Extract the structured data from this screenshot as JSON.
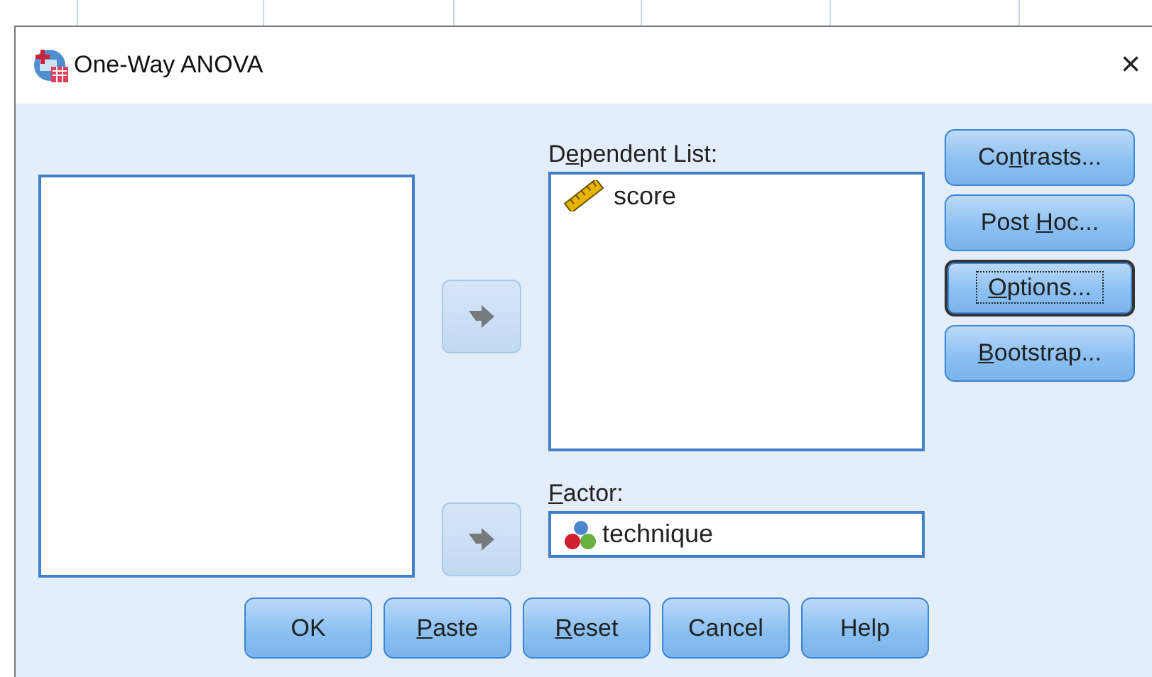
{
  "window": {
    "title": "One-Way ANOVA",
    "close": "×"
  },
  "move_buttons": [
    {
      "disabled": true
    },
    {
      "disabled": true
    }
  ],
  "dependent_list": {
    "label": {
      "pre": "D",
      "key": "e",
      "post": "pendent List:"
    },
    "items": [
      {
        "name": "score",
        "kind": "scale"
      }
    ]
  },
  "factor": {
    "label": {
      "key": "F",
      "post": "actor:"
    },
    "value": "technique",
    "kind": "nominal"
  },
  "side_buttons": [
    {
      "label": {
        "pre": "Co",
        "key": "n",
        "post": "trasts..."
      },
      "focused": false
    },
    {
      "label": {
        "pre": "Post ",
        "key": "H",
        "post": "oc..."
      },
      "focused": false
    },
    {
      "label": {
        "key": "O",
        "post": "ptions..."
      },
      "focused": true
    },
    {
      "label": {
        "key": "B",
        "post": "ootstrap..."
      },
      "focused": false
    }
  ],
  "bottom_buttons": [
    {
      "label": {
        "pre": "OK"
      }
    },
    {
      "label": {
        "key": "P",
        "post": "aste"
      }
    },
    {
      "label": {
        "key": "R",
        "post": "eset"
      }
    },
    {
      "label": {
        "pre": "Cancel"
      }
    },
    {
      "label": {
        "pre": "Help"
      }
    }
  ]
}
